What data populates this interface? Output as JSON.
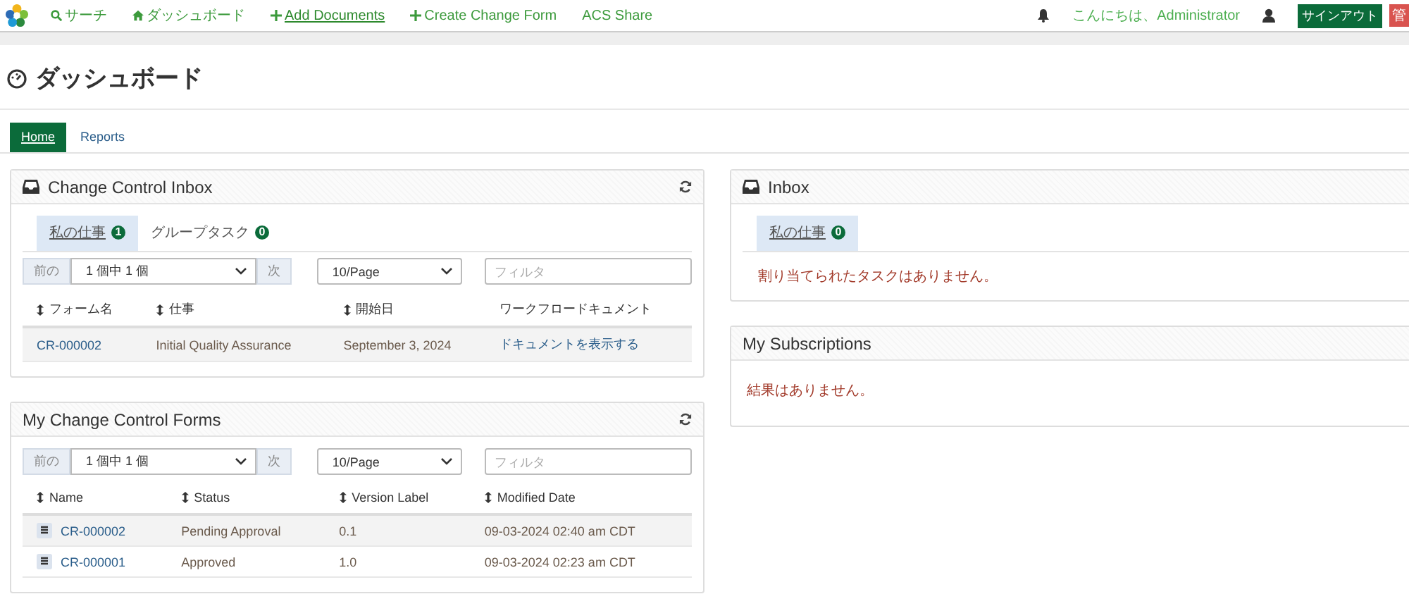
{
  "navbar": {
    "items": [
      {
        "kind": "search",
        "label": "サーチ",
        "hover": false
      },
      {
        "kind": "home",
        "label": "ダッシュボード",
        "hover": false
      },
      {
        "kind": "add",
        "label": "Add Documents",
        "hover": true
      },
      {
        "kind": "add",
        "label": "Create Change Form",
        "hover": false
      },
      {
        "kind": "plain",
        "label": "ACS Share",
        "hover": false
      }
    ],
    "greeting": "こんにちは、Administrator",
    "sign_out": "サインアウト",
    "admin": "管"
  },
  "page_title": "ダッシュボード",
  "tabs": [
    {
      "label": "Home",
      "selected": true
    },
    {
      "label": "Reports",
      "selected": false
    }
  ],
  "columns": [
    [
      {
        "title": "Change Control Inbox",
        "kind": "inbox",
        "subtabs": [
          {
            "label": "私の仕事",
            "count": "1",
            "selected": true
          },
          {
            "label": "グループタスク",
            "count": "0",
            "selected": false
          }
        ],
        "pager": {
          "prev": "前の",
          "page": "1 個中 1 個",
          "next": "次",
          "page_size": "10/Page",
          "filter_placeholder": "フィルタ"
        },
        "table": {
          "row_icon": false,
          "columns": [
            {
              "label": "フォーム名",
              "sortable": true
            },
            {
              "label": "仕事",
              "sortable": true
            },
            {
              "label": "開始日",
              "sortable": true
            },
            {
              "label": "ワークフロードキュメント",
              "sortable": false
            }
          ],
          "rows": [
            [
              {
                "text": "CR-000002",
                "link": true
              },
              {
                "text": "Initial Quality Assurance",
                "link": false
              },
              {
                "text": "September 3, 2024",
                "link": false
              },
              {
                "text": "ドキュメントを表示する",
                "link": true
              }
            ]
          ]
        }
      },
      {
        "title": "My Change Control Forms",
        "kind": "plain",
        "pager": {
          "prev": "前の",
          "page": "1 個中 1 個",
          "next": "次",
          "page_size": "10/Page",
          "filter_placeholder": "フィルタ"
        },
        "table": {
          "row_icon": true,
          "columns": [
            {
              "label": "Name",
              "sortable": true
            },
            {
              "label": "Status",
              "sortable": true
            },
            {
              "label": "Version Label",
              "sortable": true
            },
            {
              "label": "Modified Date",
              "sortable": true
            }
          ],
          "rows": [
            [
              {
                "text": "CR-000002",
                "link": true
              },
              {
                "text": "Pending Approval",
                "link": false
              },
              {
                "text": "0.1",
                "link": false
              },
              {
                "text": "09-03-2024 02:40 am CDT",
                "link": false
              }
            ],
            [
              {
                "text": "CR-000001",
                "link": true
              },
              {
                "text": "Approved",
                "link": false
              },
              {
                "text": "1.0",
                "link": false
              },
              {
                "text": "09-03-2024 02:23 am CDT",
                "link": false
              }
            ]
          ]
        }
      }
    ],
    [
      {
        "title": "Inbox",
        "kind": "inbox",
        "subtabs": [
          {
            "label": "私の仕事",
            "count": "0",
            "selected": true
          }
        ],
        "message": "割り当てられたタスクはありません。"
      },
      {
        "title": "My Subscriptions",
        "kind": "plain",
        "message": "結果はありません。"
      }
    ]
  ]
}
